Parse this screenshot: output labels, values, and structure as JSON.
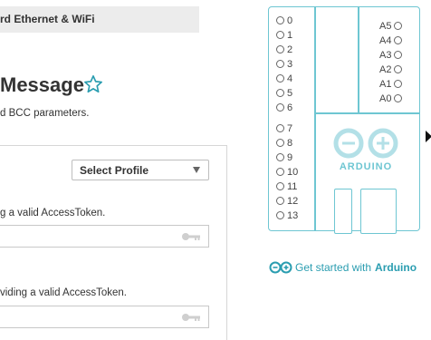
{
  "header": {
    "breadcrumb_text": "rd Ethernet & WiFi"
  },
  "main": {
    "title": "Message",
    "subtitle": "d BCC parameters.",
    "profile_select": {
      "selected": "Select Profile"
    },
    "fields": [
      {
        "help": "g a valid AccessToken.",
        "value": ""
      },
      {
        "help": "viding a valid AccessToken.",
        "value": ""
      }
    ]
  },
  "board": {
    "left_pins": [
      "0",
      "1",
      "2",
      "3",
      "4",
      "5",
      "6",
      "7",
      "8",
      "9",
      "10",
      "11",
      "12",
      "13"
    ],
    "right_pins": [
      "A5",
      "A4",
      "A3",
      "A2",
      "A1",
      "A0"
    ],
    "logo_text": "ARDUINO"
  },
  "get_started": {
    "prefix": "Get started with",
    "brand": "Arduino"
  },
  "icons": {
    "star": "star-outline-icon",
    "key": "key-icon",
    "cursor": "mouse-cursor-icon",
    "logo": "arduino-infinity-icon"
  },
  "colors": {
    "accent": "#2a9db0",
    "board_outline": "#6ec6d2",
    "header_bg": "#ececec"
  }
}
